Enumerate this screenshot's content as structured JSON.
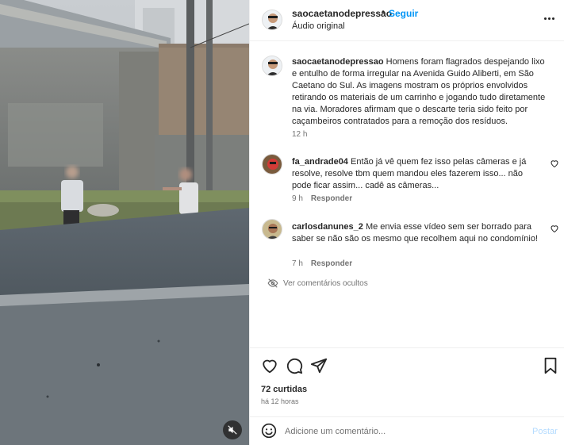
{
  "post": {
    "username": "saocaetanodepressao",
    "separator": "•",
    "follow_label": "Seguir",
    "audio_label": "Áudio original"
  },
  "caption": {
    "username": "saocaetanodepressao",
    "text": "Homens foram flagrados despejando lixo e entulho de forma irregular na Avenida Guido Aliberti, em São Caetano do Sul. As imagens mostram os próprios envolvidos retirando os materiais de um carrinho e jogando tudo diretamente na via. Moradores afirmam que o descarte teria sido feito por caçambeiros contratados para a remoção dos resíduos.",
    "time": "12 h"
  },
  "comments": [
    {
      "username": "fa_andrade04",
      "text": "Então já vê quem fez isso pelas câmeras e já resolve, resolve tbm quem mandou eles fazerem isso... não pode ficar assim... cadê as câmeras...",
      "time": "9 h",
      "reply_label": "Responder"
    },
    {
      "username": "carlosdanunes_2",
      "text": "Me envia esse vídeo sem ser borrado para saber se não são os mesmo que recolhem aqui no condomínio!",
      "time": "7 h",
      "reply_label": "Responder"
    }
  ],
  "hidden_comments_label": "Ver comentários ocultos",
  "stats": {
    "likes": "72 curtidas",
    "when": "há 12 horas"
  },
  "composer": {
    "placeholder": "Adicione um comentário...",
    "post_label": "Postar"
  },
  "colors": {
    "accent": "#0095f6",
    "muted": "#737373",
    "text": "#262626",
    "post_disabled": "#b3dbff"
  },
  "icons": {
    "more": "more-horizontal-icon",
    "like": "heart-icon",
    "comment": "comment-bubble-icon",
    "share": "paper-plane-icon",
    "save": "bookmark-icon",
    "emoji": "smiley-icon",
    "hidden": "eye-slash-icon",
    "mute": "speaker-muted-icon"
  }
}
